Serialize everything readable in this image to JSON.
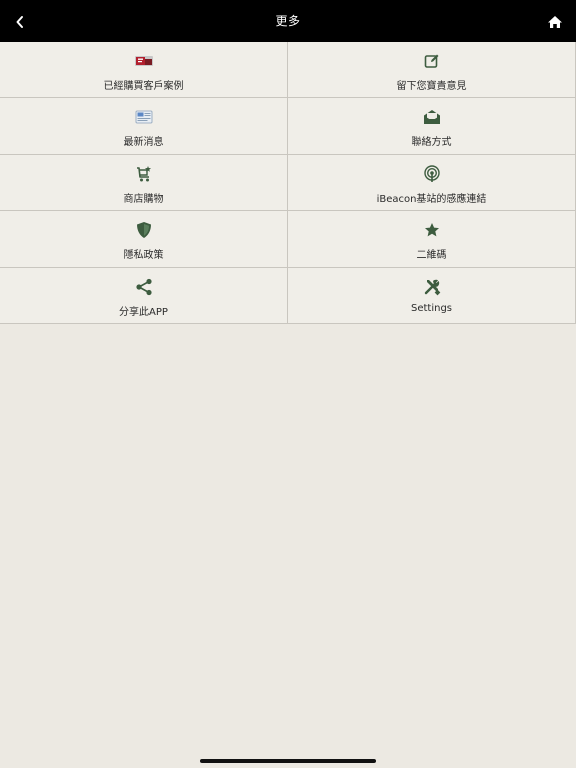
{
  "navbar": {
    "title": "更多",
    "back_icon": "chevron-left-icon",
    "home_icon": "home-icon"
  },
  "menu": [
    {
      "label": "已經購買客戶案例",
      "icon": "customer-cases-icon"
    },
    {
      "label": "留下您寶貴意見",
      "icon": "feedback-edit-icon"
    },
    {
      "label": "最新消息",
      "icon": "news-icon"
    },
    {
      "label": "聯絡方式",
      "icon": "envelope-open-icon"
    },
    {
      "label": "商店購物",
      "icon": "shopping-cart-icon"
    },
    {
      "label": "iBeacon基站的感應連結",
      "icon": "beacon-icon"
    },
    {
      "label": "隱私政策",
      "icon": "shield-icon"
    },
    {
      "label": "二維碼",
      "icon": "star-icon"
    },
    {
      "label": "分享此APP",
      "icon": "share-icon"
    },
    {
      "label": "Settings",
      "icon": "tools-icon"
    }
  ],
  "colors": {
    "navbar_bg": "#000000",
    "icon_green": "#3d5c3f",
    "background": "#ece9e2"
  }
}
